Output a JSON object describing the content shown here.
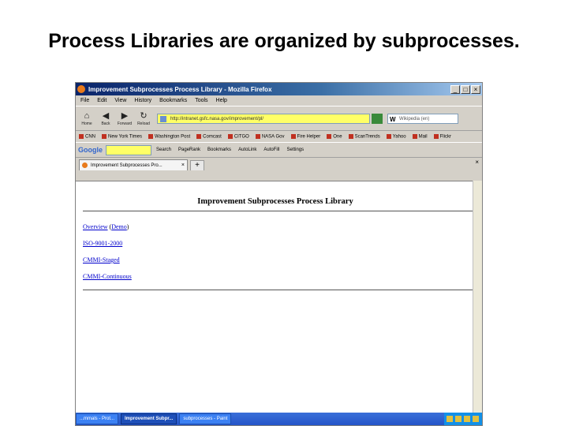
{
  "slide": {
    "title": "Process Libraries are organized by subprocesses."
  },
  "window": {
    "title": "Improvement Subprocesses Process Library - Mozilla Firefox"
  },
  "menu": [
    "File",
    "Edit",
    "View",
    "History",
    "Bookmarks",
    "Tools",
    "Help"
  ],
  "nav": {
    "back": "Back",
    "forward": "Forward",
    "reload": "Reload",
    "home": "Home"
  },
  "address": {
    "value": "http://intranet.gsfc.nasa.gov/improvement/pl/"
  },
  "search": {
    "placeholder": "Wikipedia (en)"
  },
  "bookmarks": [
    "CNN",
    "New York Times",
    "Washington Post",
    "Comcast",
    "CITGO",
    "NASA Gov",
    "Fire Helper",
    "One",
    "ScanTrends",
    "Yahoo",
    "Mail",
    "Flickr"
  ],
  "google_toolbar": {
    "logo": "Google",
    "items": [
      "Search",
      "PageRank",
      "Bookmarks",
      "AutoLink",
      "AutoFill",
      "Settings"
    ]
  },
  "tabs": [
    {
      "label": "Improvement Subprocesses Pro..."
    }
  ],
  "page": {
    "heading": "Improvement Subprocesses Process Library",
    "links": {
      "overview": "Overview",
      "demo": "Demo",
      "iso": "ISO-9001-2000",
      "cmmi_staged": "CMMI-Staged",
      "cmmi_continuous": "CMMI-Continuous"
    }
  },
  "taskbar": {
    "items": [
      "...mmals - Prot...",
      "Improvement Subpr...",
      "subprocesses - Paint"
    ]
  },
  "colors": {
    "title_bar": "#0a246a",
    "address_bg": "#ffff66",
    "link": "#0000cc",
    "taskbar": "#2454c8"
  }
}
